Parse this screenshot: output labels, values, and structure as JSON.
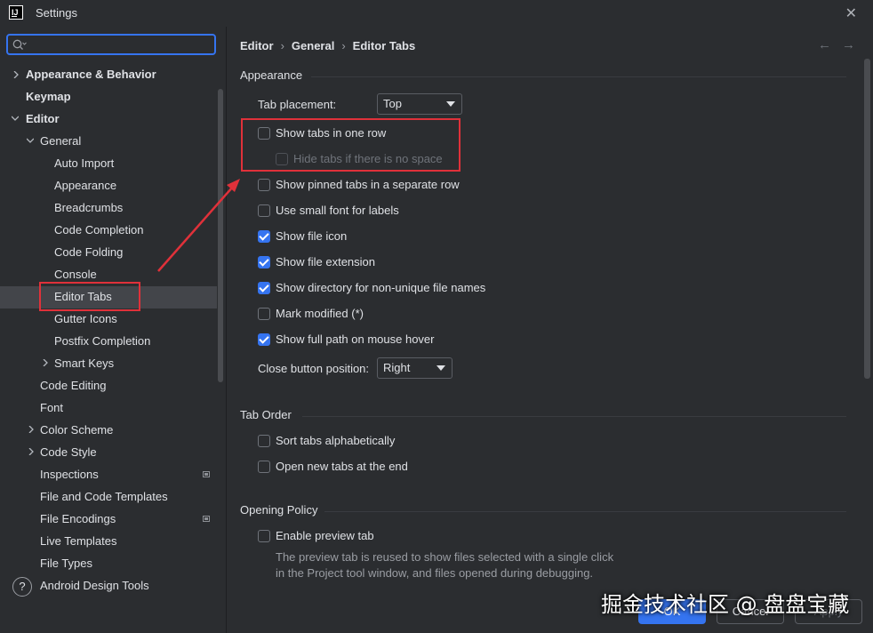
{
  "window": {
    "title": "Settings",
    "app_icon_text": "IJ"
  },
  "search": {
    "value": "",
    "placeholder": ""
  },
  "sidebar": {
    "items": [
      {
        "label": "Appearance & Behavior"
      },
      {
        "label": "Keymap"
      },
      {
        "label": "Editor"
      },
      {
        "label": "General"
      },
      {
        "label": "Auto Import"
      },
      {
        "label": "Appearance"
      },
      {
        "label": "Breadcrumbs"
      },
      {
        "label": "Code Completion"
      },
      {
        "label": "Code Folding"
      },
      {
        "label": "Console"
      },
      {
        "label": "Editor Tabs"
      },
      {
        "label": "Gutter Icons"
      },
      {
        "label": "Postfix Completion"
      },
      {
        "label": "Smart Keys"
      },
      {
        "label": "Code Editing"
      },
      {
        "label": "Font"
      },
      {
        "label": "Color Scheme"
      },
      {
        "label": "Code Style"
      },
      {
        "label": "Inspections"
      },
      {
        "label": "File and Code Templates"
      },
      {
        "label": "File Encodings"
      },
      {
        "label": "Live Templates"
      },
      {
        "label": "File Types"
      },
      {
        "label": "Android Design Tools"
      }
    ],
    "help": "?"
  },
  "breadcrumb": {
    "items": [
      "Editor",
      "General",
      "Editor Tabs"
    ],
    "sep": "›"
  },
  "nav": {
    "back": "←",
    "forward": "→"
  },
  "appearance": {
    "title": "Appearance",
    "tab_placement_label": "Tab placement:",
    "tab_placement_value": "Top",
    "options": [
      {
        "label": "Show tabs in one row",
        "checked": false
      },
      {
        "label": "Hide tabs if there is no space",
        "checked": false,
        "disabled": true
      },
      {
        "label": "Show pinned tabs in a separate row",
        "checked": false
      },
      {
        "label": "Use small font for labels",
        "checked": false
      },
      {
        "label": "Show file icon",
        "checked": true
      },
      {
        "label": "Show file extension",
        "checked": true
      },
      {
        "label": "Show directory for non-unique file names",
        "checked": true
      },
      {
        "label": "Mark modified (*)",
        "checked": false
      },
      {
        "label": "Show full path on mouse hover",
        "checked": true
      }
    ],
    "close_button_label": "Close button position:",
    "close_button_value": "Right"
  },
  "tab_order": {
    "title": "Tab Order",
    "options": [
      {
        "label": "Sort tabs alphabetically",
        "checked": false
      },
      {
        "label": "Open new tabs at the end",
        "checked": false
      }
    ]
  },
  "opening_policy": {
    "title": "Opening Policy",
    "options": [
      {
        "label": "Enable preview tab",
        "checked": false
      }
    ],
    "description_line1": "The preview tab is reused to show files selected with a single click",
    "description_line2": "in the Project tool window, and files opened during debugging."
  },
  "buttons": {
    "ok": "OK",
    "cancel": "Cancel",
    "apply": "Apply"
  },
  "watermark": "掘金技术社区 @ 盘盘宝藏",
  "colors": {
    "accent": "#3574f0",
    "highlight_box": "#e0313a",
    "background": "#2b2d30"
  }
}
